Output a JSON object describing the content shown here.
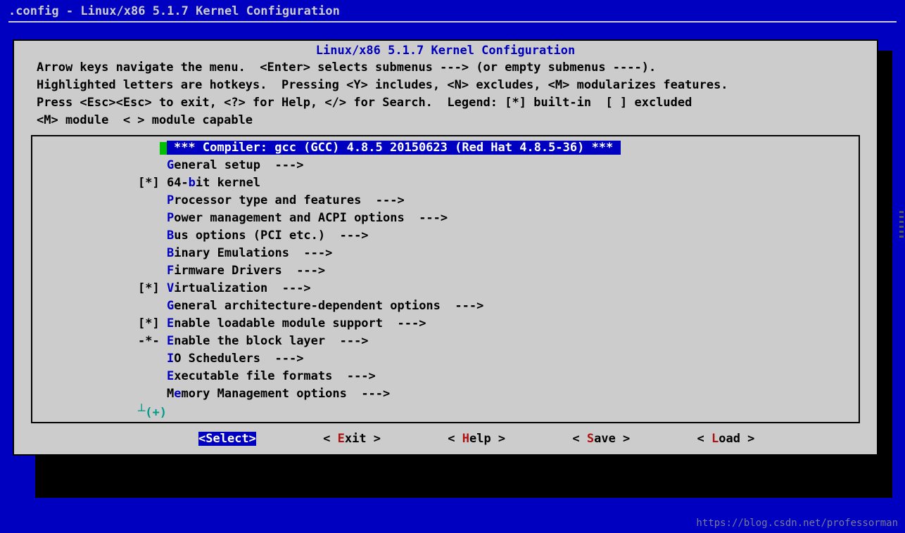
{
  "window_title": ".config - Linux/x86 5.1.7 Kernel Configuration",
  "dialog_title": "Linux/x86 5.1.7 Kernel Configuration",
  "help": "Arrow keys navigate the menu.  <Enter> selects submenus ---> (or empty submenus ----).\nHighlighted letters are hotkeys.  Pressing <Y> includes, <N> excludes, <M> modularizes features.\nPress <Esc><Esc> to exit, <?> for Help, </> for Search.  Legend: [*] built-in  [ ] excluded\n<M> module  < > module capable",
  "menu": [
    {
      "prefix": "   ",
      "selected": true,
      "text": " *** Compiler: gcc (GCC) 4.8.5 20150623 (Red Hat 4.8.5-36) *** "
    },
    {
      "prefix": "    ",
      "hot": "G",
      "rest": "eneral setup  --->"
    },
    {
      "prefix": "[*] ",
      "pre2": "64-",
      "hot": "b",
      "rest": "it kernel"
    },
    {
      "prefix": "    ",
      "hot": "P",
      "rest": "rocessor type and features  --->"
    },
    {
      "prefix": "    ",
      "hot": "P",
      "rest": "ower management and ACPI options  --->"
    },
    {
      "prefix": "    ",
      "hot": "B",
      "rest": "us options (PCI etc.)  --->"
    },
    {
      "prefix": "    ",
      "hot": "B",
      "rest": "inary Emulations  --->"
    },
    {
      "prefix": "    ",
      "hot": "F",
      "rest": "irmware Drivers  --->"
    },
    {
      "prefix": "[*] ",
      "hot": "V",
      "rest": "irtualization  --->"
    },
    {
      "prefix": "    ",
      "hot": "G",
      "rest": "eneral architecture-dependent options  --->"
    },
    {
      "prefix": "[*] ",
      "hot": "E",
      "rest": "nable loadable module support  --->"
    },
    {
      "prefix": "-*- ",
      "hot": "E",
      "rest": "nable the block layer  --->"
    },
    {
      "prefix": "    ",
      "hot": "I",
      "rest": "O Schedulers  --->"
    },
    {
      "prefix": "    ",
      "hot": "E",
      "rest": "xecutable file formats  --->"
    },
    {
      "prefix": "    ",
      "pre2": "M",
      "hot": "e",
      "rest": "mory Management options  --->"
    }
  ],
  "more": "(+)",
  "buttons": [
    {
      "label": "Select",
      "hot": "S",
      "rest": "elect",
      "selected": true
    },
    {
      "label": "Exit",
      "hot": "E",
      "rest": "xit",
      "selected": false
    },
    {
      "label": "Help",
      "hot": "H",
      "rest": "elp",
      "selected": false
    },
    {
      "label": "Save",
      "hot": "S",
      "rest": "ave",
      "selected": false
    },
    {
      "label": "Load",
      "hot": "L",
      "rest": "oad",
      "selected": false
    }
  ],
  "watermark": "https://blog.csdn.net/professorman"
}
